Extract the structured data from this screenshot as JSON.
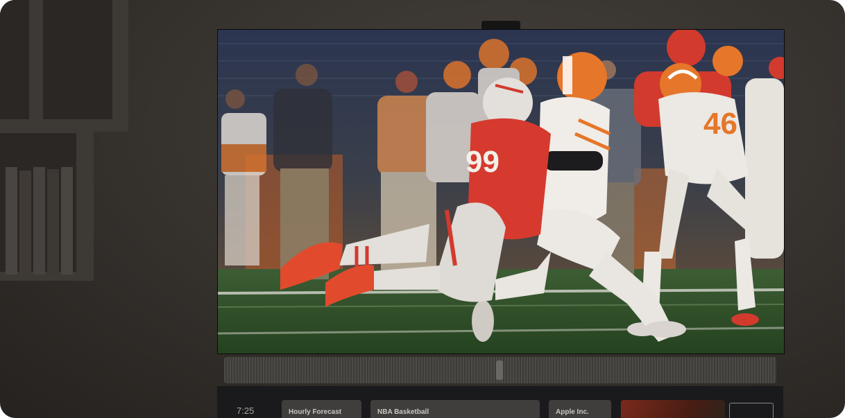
{
  "dock": {
    "time": "7:25",
    "tiles": [
      {
        "label": "Hourly Forecast"
      },
      {
        "label": "NBA Basketball"
      },
      {
        "label": "Apple Inc."
      }
    ]
  },
  "jerseys": {
    "defender_number": "99",
    "runner_number": "46"
  },
  "colors": {
    "wall": "#34302c",
    "screen_field": "#2e5a2e",
    "red_team": "#d23a2e",
    "orange_helmet": "#e5762a"
  },
  "icons": [
    "shelf-books-decoration",
    "tv-camera-icon",
    "soundbar-icon"
  ]
}
